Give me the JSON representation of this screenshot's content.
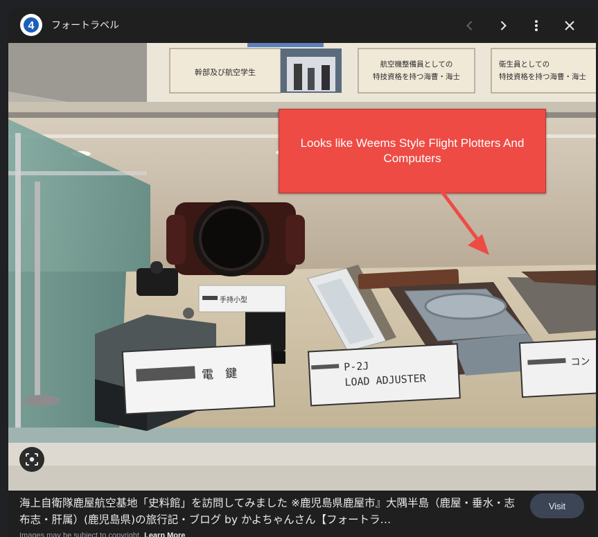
{
  "header": {
    "site_name": "フォートラベル",
    "logo_text": "4"
  },
  "photo": {
    "annotation": "Looks like Weems Style Flight Plotters And Computers",
    "sign_1": "幹部及び航空学生",
    "sign_2_line1": "航空機整備員としての",
    "sign_2_line2": "特技資格を持つ海曹・海士",
    "sign_3_line1": "衛生員としての",
    "sign_3_line2": "特技資格を持つ海曹・海士",
    "label_key": "電　鍵",
    "label_adjuster_line1": "P-2J",
    "label_adjuster_line2": "LOAD ADJUSTER",
    "label_small": "手持小型",
    "label_right": "コン"
  },
  "caption": {
    "title": "海上自衛隊鹿屋航空基地「史料館」を訪問してみました ※鹿児島県鹿屋市』大隅半島（鹿屋・垂水・志布志・肝属）(鹿児島県)の旅行記・ブログ by かよちゃんさん【フォートラ…",
    "visit_label": "Visit",
    "copyright": "Images may be subject to copyright.",
    "learn_more": "Learn More"
  },
  "colors": {
    "callout": "#ee4b45",
    "visit_bg": "#3c4555",
    "background": "#202124"
  },
  "icons": {
    "prev": "chevron-left-icon",
    "next": "chevron-right-icon",
    "more": "more-vert-icon",
    "close": "close-icon",
    "lens": "lens-icon"
  }
}
